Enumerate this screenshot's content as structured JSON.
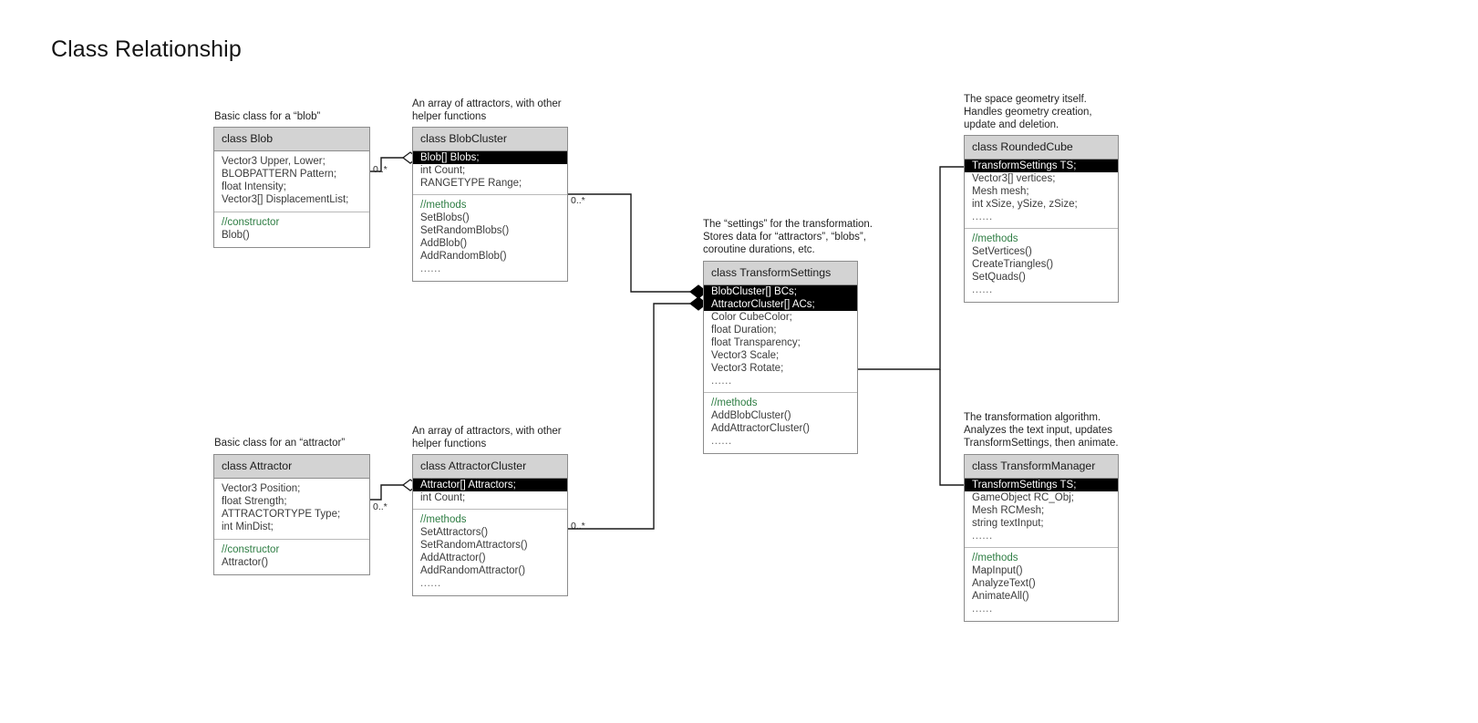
{
  "page": {
    "title": "Class Relationship"
  },
  "notes": [
    {
      "id": "note-blob",
      "text": "Basic class for a “blob”"
    },
    {
      "id": "note-blobcluster",
      "text": "An array of attractors, with other\nhelper functions"
    },
    {
      "id": "note-roundedcube",
      "text": "The space geometry itself.\nHandles geometry creation,\nupdate and deletion."
    },
    {
      "id": "note-transformsettings",
      "text": "The “settings” for the transformation.\nStores data for “attractors”, “blobs”,\ncoroutine durations, etc."
    },
    {
      "id": "note-attractor",
      "text": "Basic class for an “attractor”"
    },
    {
      "id": "note-attractorcluster",
      "text": "An array of attractors, with other\nhelper functions"
    },
    {
      "id": "note-transformmanager",
      "text": "The transformation algorithm.\nAnalyzes the text input, updates\nTransformSettings, then animate."
    }
  ],
  "classes": {
    "blob": {
      "name": "class Blob",
      "attributes": [
        {
          "text": "Vector3 Upper, Lower;",
          "highlight": false
        },
        {
          "text": "BLOBPATTERN Pattern;",
          "highlight": false
        },
        {
          "text": "float Intensity;",
          "highlight": false
        },
        {
          "text": "Vector3[] DisplacementList;",
          "highlight": false
        }
      ],
      "members": [
        {
          "text": "//constructor",
          "comment": true
        },
        {
          "text": "Blob()"
        }
      ]
    },
    "blobcluster": {
      "name": "class BlobCluster",
      "attributes": [
        {
          "text": "Blob[] Blobs;",
          "highlight": true
        },
        {
          "text": "int Count;",
          "highlight": false
        },
        {
          "text": "RANGETYPE Range;",
          "highlight": false
        }
      ],
      "members": [
        {
          "text": "//methods",
          "comment": true
        },
        {
          "text": "SetBlobs()"
        },
        {
          "text": "SetRandomBlobs()"
        },
        {
          "text": "AddBlob()"
        },
        {
          "text": "AddRandomBlob()"
        },
        {
          "text": "......",
          "dots": true
        }
      ]
    },
    "roundedcube": {
      "name": "class RoundedCube",
      "attributes": [
        {
          "text": "TransformSettings TS;",
          "highlight": true
        },
        {
          "text": "Vector3[] vertices;",
          "highlight": false
        },
        {
          "text": "Mesh mesh;",
          "highlight": false
        },
        {
          "text": "int xSize, ySize, zSize;",
          "highlight": false
        },
        {
          "text": "......",
          "highlight": false,
          "dots": true
        }
      ],
      "members": [
        {
          "text": "//methods",
          "comment": true
        },
        {
          "text": "SetVertices()"
        },
        {
          "text": "CreateTriangles()"
        },
        {
          "text": "SetQuads()"
        },
        {
          "text": "......",
          "dots": true
        }
      ]
    },
    "transformsettings": {
      "name": "class TransformSettings",
      "attributes": [
        {
          "text": "BlobCluster[] BCs;",
          "highlight": true
        },
        {
          "text": "AttractorCluster[] ACs;",
          "highlight": true
        },
        {
          "text": "Color CubeColor;",
          "highlight": false
        },
        {
          "text": "float Duration;",
          "highlight": false
        },
        {
          "text": "float Transparency;",
          "highlight": false
        },
        {
          "text": "Vector3 Scale;",
          "highlight": false
        },
        {
          "text": "Vector3 Rotate;",
          "highlight": false
        },
        {
          "text": "......",
          "highlight": false,
          "dots": true
        }
      ],
      "members": [
        {
          "text": "//methods",
          "comment": true
        },
        {
          "text": "AddBlobCluster()"
        },
        {
          "text": "AddAttractorCluster()"
        },
        {
          "text": "......",
          "dots": true
        }
      ]
    },
    "attractor": {
      "name": "class Attractor",
      "attributes": [
        {
          "text": "Vector3 Position;",
          "highlight": false
        },
        {
          "text": "float Strength;",
          "highlight": false
        },
        {
          "text": "ATTRACTORTYPE Type;",
          "highlight": false
        },
        {
          "text": "int MinDist;",
          "highlight": false
        }
      ],
      "members": [
        {
          "text": "//constructor",
          "comment": true
        },
        {
          "text": "Attractor()"
        }
      ]
    },
    "attractorcluster": {
      "name": "class AttractorCluster",
      "attributes": [
        {
          "text": "Attractor[] Attractors;",
          "highlight": true
        },
        {
          "text": "int Count;",
          "highlight": false
        }
      ],
      "members": [
        {
          "text": "//methods",
          "comment": true
        },
        {
          "text": "SetAttractors()"
        },
        {
          "text": "SetRandomAttractors()"
        },
        {
          "text": "AddAttractor()"
        },
        {
          "text": "AddRandomAttractor()"
        },
        {
          "text": "......",
          "dots": true
        }
      ]
    },
    "transformmanager": {
      "name": "class TransformManager",
      "attributes": [
        {
          "text": "TransformSettings TS;",
          "highlight": true
        },
        {
          "text": "GameObject RC_Obj;",
          "highlight": false
        },
        {
          "text": "Mesh RCMesh;",
          "highlight": false
        },
        {
          "text": "string textInput;",
          "highlight": false
        },
        {
          "text": "......",
          "highlight": false,
          "dots": true
        }
      ],
      "members": [
        {
          "text": "//methods",
          "comment": true
        },
        {
          "text": "MapInput()"
        },
        {
          "text": "AnalyzeText()"
        },
        {
          "text": "AnimateAll()"
        },
        {
          "text": "......",
          "dots": true
        }
      ]
    }
  },
  "multiplicities": [
    {
      "id": "mult-blob-blobcluster",
      "text": "0..*"
    },
    {
      "id": "mult-blobcluster-settings",
      "text": "0..*"
    },
    {
      "id": "mult-attractor-attractorcluster",
      "text": "0..*"
    },
    {
      "id": "mult-attractorcluster-settings",
      "text": "0..*"
    }
  ],
  "colors": {
    "header_fill": "#d3d3d3",
    "box_border": "#8c8c8c",
    "highlight_fill": "#000000",
    "highlight_text": "#ffffff",
    "comment_text": "#2e7d43",
    "edge": "#1a1a1a",
    "background": "#ffffff"
  }
}
